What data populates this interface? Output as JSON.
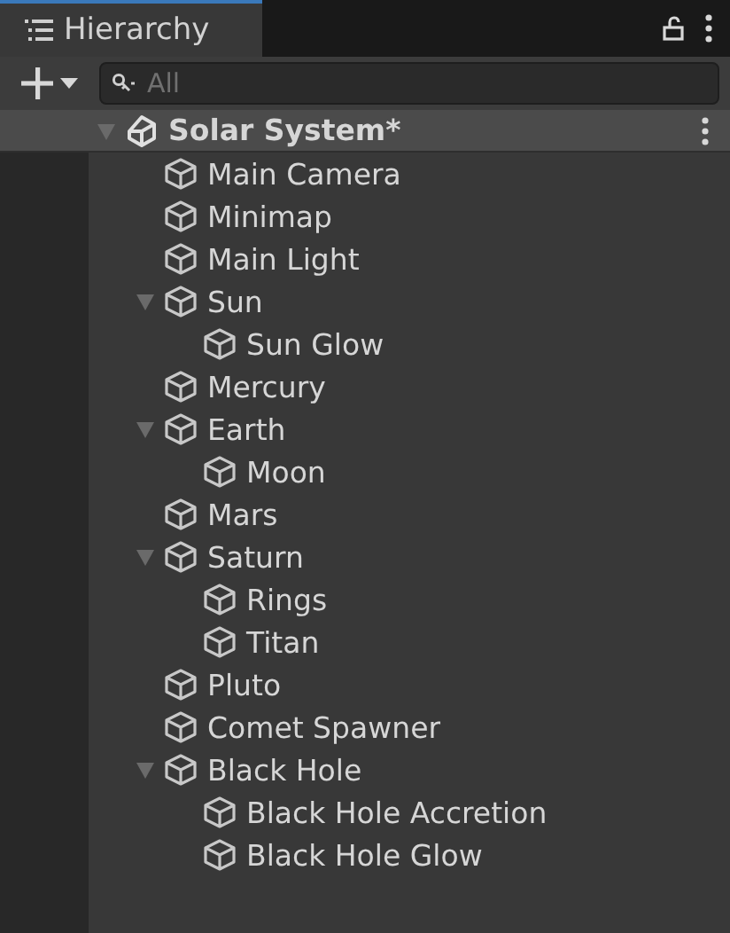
{
  "panel": {
    "title": "Hierarchy"
  },
  "search": {
    "placeholder": "All"
  },
  "scene": {
    "name": "Solar System*",
    "expanded": true,
    "children": [
      {
        "name": "Main Camera"
      },
      {
        "name": "Minimap"
      },
      {
        "name": "Main Light"
      },
      {
        "name": "Sun",
        "expanded": true,
        "children": [
          {
            "name": "Sun Glow"
          }
        ]
      },
      {
        "name": "Mercury"
      },
      {
        "name": "Earth",
        "expanded": true,
        "children": [
          {
            "name": "Moon"
          }
        ]
      },
      {
        "name": "Mars"
      },
      {
        "name": "Saturn",
        "expanded": true,
        "children": [
          {
            "name": "Rings"
          },
          {
            "name": "Titan"
          }
        ]
      },
      {
        "name": "Pluto"
      },
      {
        "name": "Comet Spawner"
      },
      {
        "name": "Black Hole",
        "expanded": true,
        "children": [
          {
            "name": "Black Hole Accretion"
          },
          {
            "name": "Black Hole Glow"
          }
        ]
      }
    ]
  }
}
